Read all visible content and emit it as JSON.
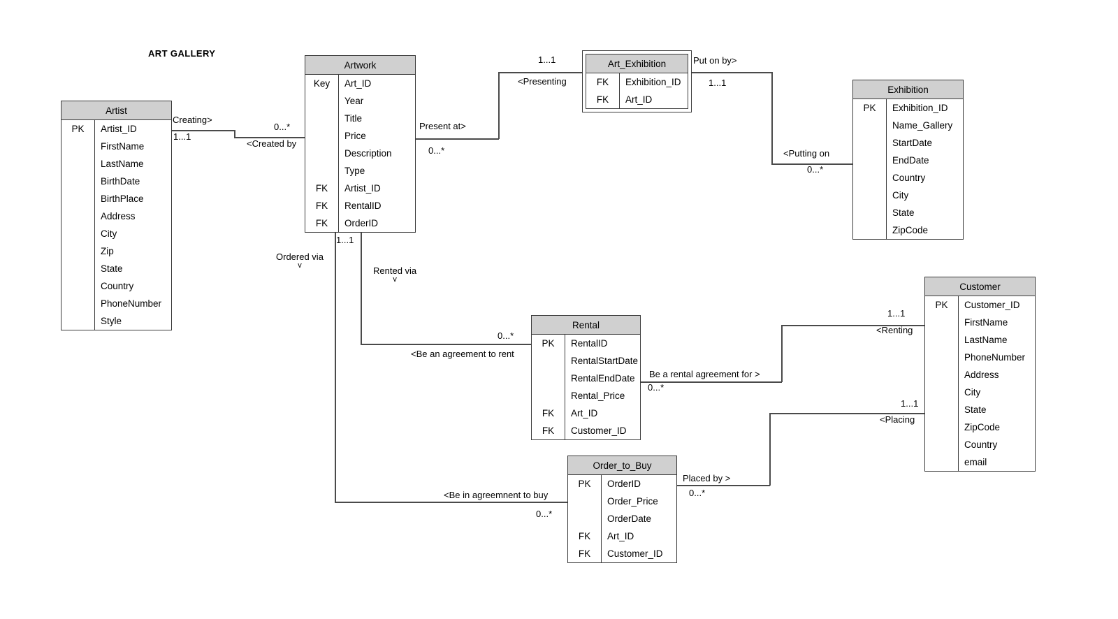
{
  "title": "ART GALLERY",
  "entities": [
    {
      "id": "artist",
      "name": "Artist",
      "rows": [
        {
          "key": "PK",
          "attr": "Artist_ID"
        },
        {
          "key": "",
          "attr": "FirstName"
        },
        {
          "key": "",
          "attr": "LastName"
        },
        {
          "key": "",
          "attr": "BirthDate"
        },
        {
          "key": "",
          "attr": "BirthPlace"
        },
        {
          "key": "",
          "attr": "Address"
        },
        {
          "key": "",
          "attr": "City"
        },
        {
          "key": "",
          "attr": "Zip"
        },
        {
          "key": "",
          "attr": "State"
        },
        {
          "key": "",
          "attr": "Country"
        },
        {
          "key": "",
          "attr": "PhoneNumber"
        },
        {
          "key": "",
          "attr": "Style"
        }
      ]
    },
    {
      "id": "artwork",
      "name": "Artwork",
      "rows": [
        {
          "key": "Key",
          "attr": "Art_ID"
        },
        {
          "key": "",
          "attr": "Year"
        },
        {
          "key": "",
          "attr": "Title"
        },
        {
          "key": "",
          "attr": "Price"
        },
        {
          "key": "",
          "attr": "Description"
        },
        {
          "key": "",
          "attr": "Type"
        },
        {
          "key": "FK",
          "attr": "Artist_ID"
        },
        {
          "key": "FK",
          "attr": "RentalID"
        },
        {
          "key": "FK",
          "attr": "OrderID"
        }
      ]
    },
    {
      "id": "art_exhibition",
      "name": "Art_Exhibition",
      "rows": [
        {
          "key": "FK",
          "attr": "Exhibition_ID"
        },
        {
          "key": "FK",
          "attr": "Art_ID"
        }
      ]
    },
    {
      "id": "exhibition",
      "name": "Exhibition",
      "rows": [
        {
          "key": "PK",
          "attr": "Exhibition_ID"
        },
        {
          "key": "",
          "attr": "Name_Gallery"
        },
        {
          "key": "",
          "attr": "StartDate"
        },
        {
          "key": "",
          "attr": "EndDate"
        },
        {
          "key": "",
          "attr": "Country"
        },
        {
          "key": "",
          "attr": "City"
        },
        {
          "key": "",
          "attr": "State"
        },
        {
          "key": "",
          "attr": "ZipCode"
        }
      ]
    },
    {
      "id": "rental",
      "name": "Rental",
      "rows": [
        {
          "key": "PK",
          "attr": "RentalID"
        },
        {
          "key": "",
          "attr": "RentalStartDate"
        },
        {
          "key": "",
          "attr": "RentalEndDate"
        },
        {
          "key": "",
          "attr": "Rental_Price"
        },
        {
          "key": "FK",
          "attr": "Art_ID"
        },
        {
          "key": "FK",
          "attr": "Customer_ID"
        }
      ]
    },
    {
      "id": "order_to_buy",
      "name": "Order_to_Buy",
      "rows": [
        {
          "key": "PK",
          "attr": "OrderID"
        },
        {
          "key": "",
          "attr": "Order_Price"
        },
        {
          "key": "",
          "attr": "OrderDate"
        },
        {
          "key": "FK",
          "attr": "Art_ID"
        },
        {
          "key": "FK",
          "attr": "Customer_ID"
        }
      ]
    },
    {
      "id": "customer",
      "name": "Customer",
      "rows": [
        {
          "key": "PK",
          "attr": "Customer_ID"
        },
        {
          "key": "",
          "attr": "FirstName"
        },
        {
          "key": "",
          "attr": "LastName"
        },
        {
          "key": "",
          "attr": "PhoneNumber"
        },
        {
          "key": "",
          "attr": "Address"
        },
        {
          "key": "",
          "attr": "City"
        },
        {
          "key": "",
          "attr": "State"
        },
        {
          "key": "",
          "attr": "ZipCode"
        },
        {
          "key": "",
          "attr": "Country"
        },
        {
          "key": "",
          "attr": "email"
        }
      ]
    }
  ],
  "labels": {
    "creating": "Creating>",
    "artist_card": "1...1",
    "created_by": "<Created by",
    "artwork_card_artist": "0...*",
    "present_at": "Present at>",
    "artwork_card_exh": "0...*",
    "presenting": "<Presenting",
    "artexh_card_left": "1...1",
    "put_on_by": "Put on by>",
    "artexh_card_right": "1...1",
    "putting_on": "<Putting on",
    "exhibition_card": "0...*",
    "ordered_via": "Ordered via",
    "ordered_via_chev": "v",
    "rented_via": "Rented via",
    "rented_via_chev": "v",
    "artwork_card_down": "1...1",
    "be_agreement_rent": "<Be an agreement to rent",
    "rental_card_left": "0...*",
    "be_rental_agreement_for": "Be a rental agreement for >",
    "rental_card_right": "0...*",
    "renting": "<Renting",
    "customer_card_rent": "1...1",
    "be_in_agreement_buy": "<Be in agreemnent to buy",
    "order_card_left": "0...*",
    "placed_by": "Placed by >",
    "order_card_right": "0...*",
    "placing": "<Placing",
    "customer_card_order": "1...1"
  },
  "colors": {
    "header_fill": "#d0d0d0",
    "border": "#3a3a3a",
    "line": "#4a4a4a",
    "background": "#ffffff"
  }
}
